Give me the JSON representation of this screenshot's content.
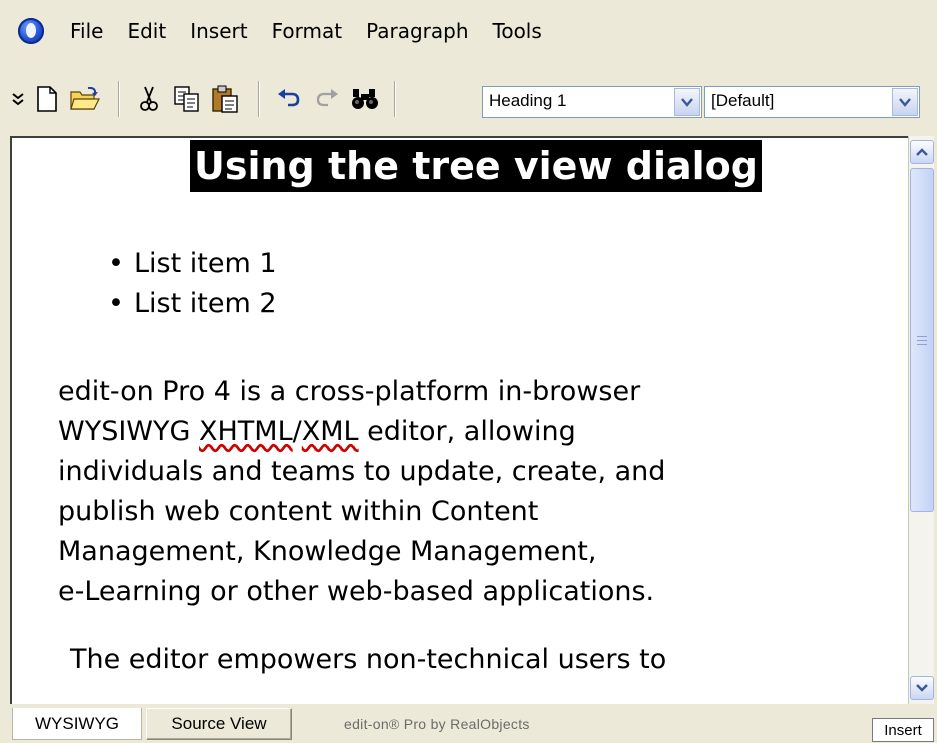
{
  "menu": {
    "items": [
      "File",
      "Edit",
      "Insert",
      "Format",
      "Paragraph",
      "Tools"
    ]
  },
  "toolbar": {
    "icons": [
      "chevron-more-icon",
      "new-document-icon",
      "open-folder-icon",
      "cut-icon",
      "copy-icon",
      "paste-icon",
      "undo-icon",
      "redo-icon",
      "find-icon"
    ],
    "paragraph_style": "Heading 1",
    "font_style": "[Default]"
  },
  "document": {
    "heading": "Using the tree view dialog",
    "list_items": [
      "List item 1",
      "List item 2"
    ],
    "paragraph": {
      "line1": "edit-on Pro 4 is a cross-platform in-browser",
      "line2_a": "WYSIWYG ",
      "line2_b": "XHTML",
      "line2_c": "/",
      "line2_d": "XML",
      "line2_e": " editor, allowing",
      "line3": "individuals and teams to update, create, and",
      "line4": "publish web content within Content",
      "line5": "Management, Knowledge Management,",
      "line6": "e-Learning or other web-based applications."
    },
    "paragraph2": "The editor empowers non-technical users to"
  },
  "bottom": {
    "tab_wysiwyg": "WYSIWYG",
    "tab_source": "Source View",
    "brand": "edit-on® Pro by RealObjects",
    "mode": "Insert"
  },
  "colors": {
    "accent": "#1f4fd1",
    "chrome": "#ece9d8",
    "spellcheck": "#d00000"
  }
}
